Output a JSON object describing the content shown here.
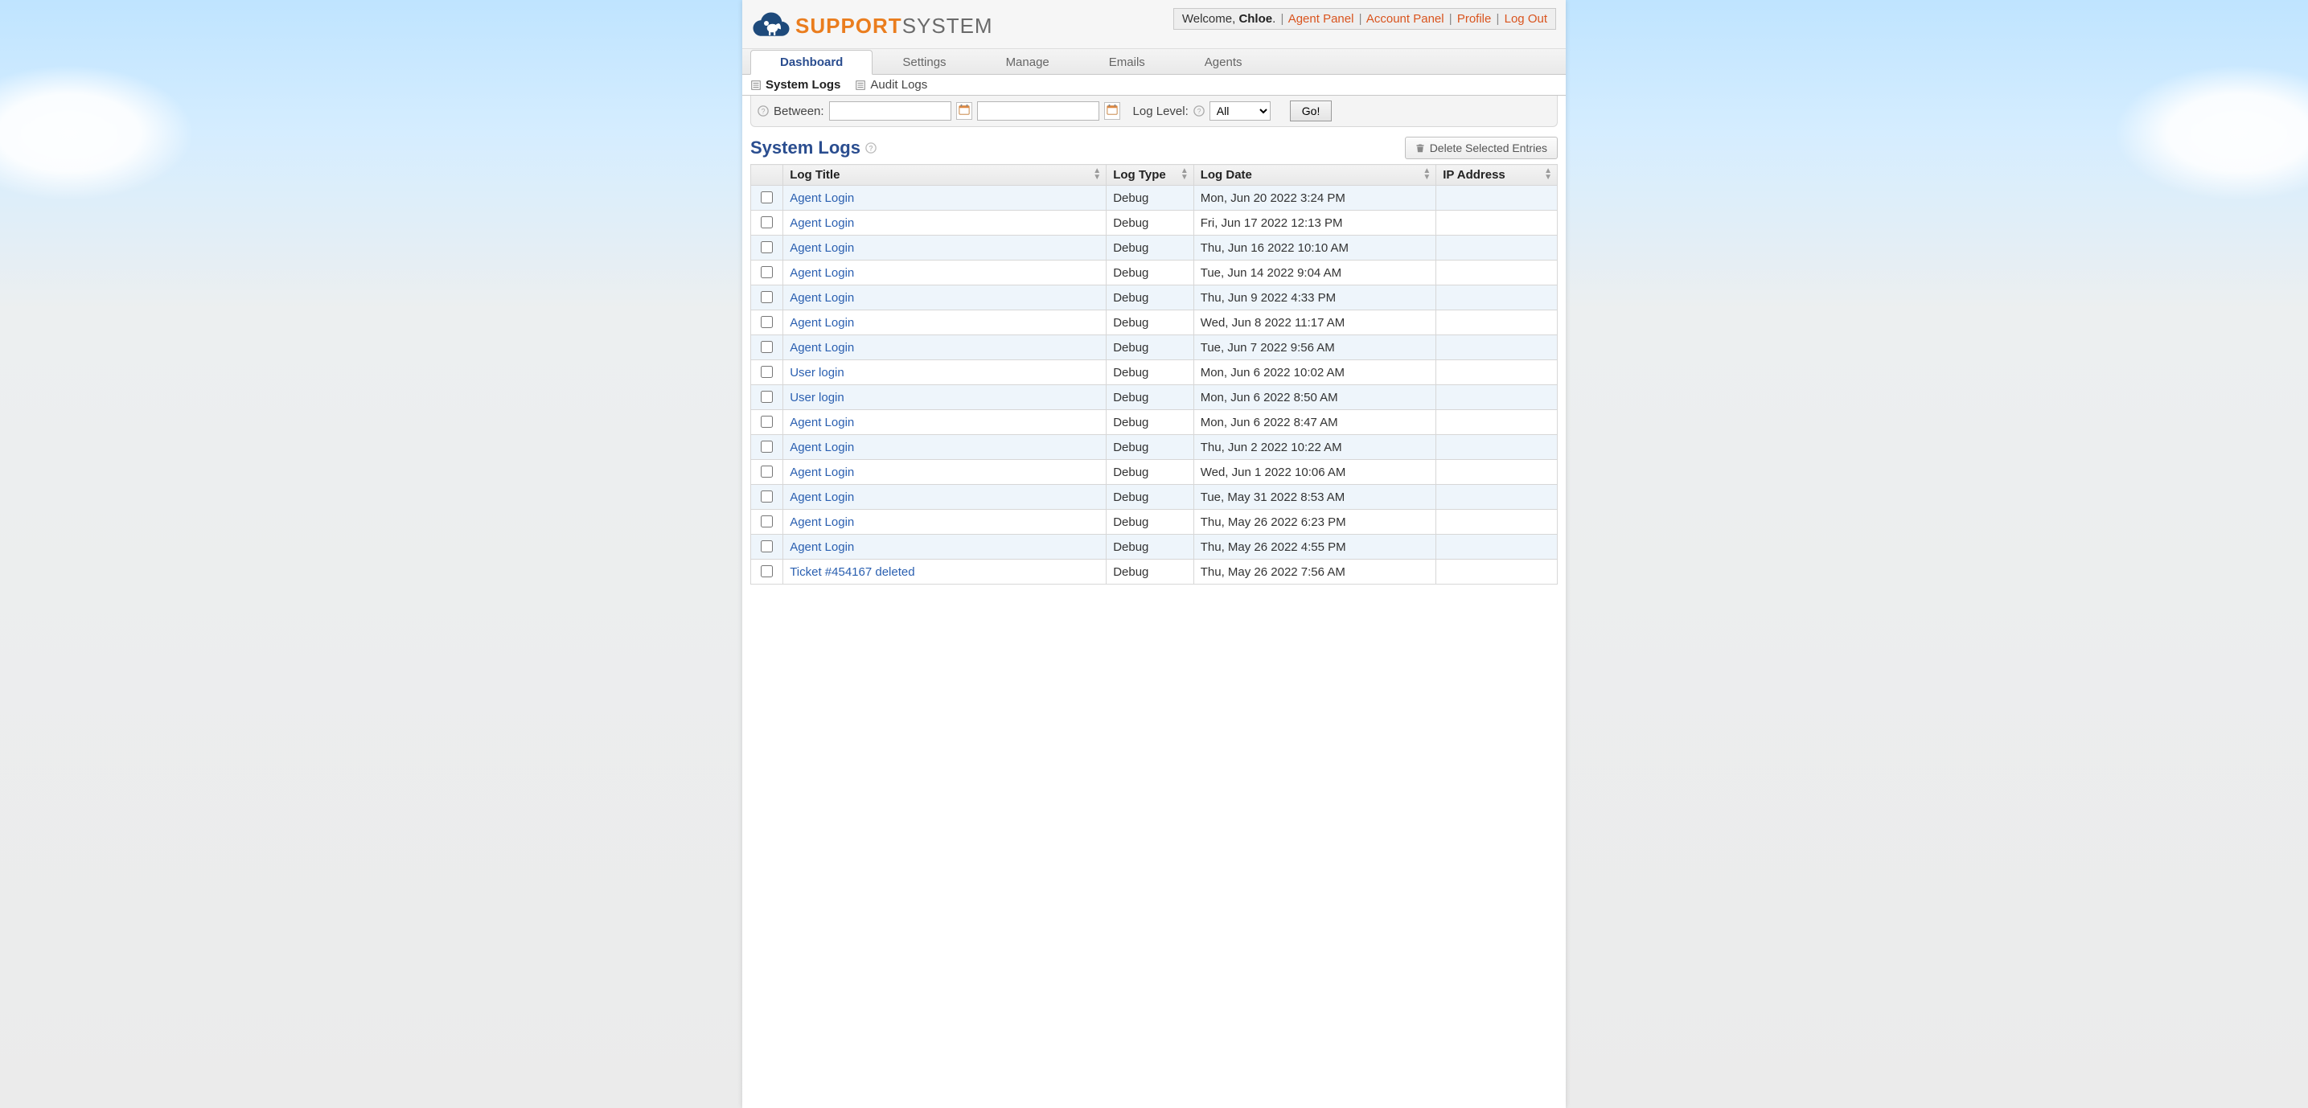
{
  "header": {
    "welcome_prefix": "Welcome, ",
    "username": "Chloe",
    "links": {
      "agent_panel": "Agent Panel",
      "account_panel": "Account Panel",
      "profile": "Profile",
      "logout": "Log Out"
    }
  },
  "logo": {
    "support": "SUPPORT",
    "system": "SYSTEM"
  },
  "tabs": [
    {
      "id": "dashboard",
      "label": "Dashboard",
      "active": true
    },
    {
      "id": "settings",
      "label": "Settings",
      "active": false
    },
    {
      "id": "manage",
      "label": "Manage",
      "active": false
    },
    {
      "id": "emails",
      "label": "Emails",
      "active": false
    },
    {
      "id": "agents",
      "label": "Agents",
      "active": false
    }
  ],
  "subtabs": [
    {
      "id": "system-logs",
      "label": "System Logs",
      "active": true
    },
    {
      "id": "audit-logs",
      "label": "Audit Logs",
      "active": false
    }
  ],
  "filter": {
    "between_label": "Between:",
    "date_from": "",
    "date_to": "",
    "log_level_label": "Log Level:",
    "log_level_selected": "All",
    "go_label": "Go!"
  },
  "page_title": "System Logs",
  "delete_button": "Delete Selected Entries",
  "columns": {
    "title": "Log Title",
    "type": "Log Type",
    "date": "Log Date",
    "ip": "IP Address"
  },
  "rows": [
    {
      "title": "Agent Login",
      "type": "Debug",
      "date": "Mon, Jun 20 2022 3:24 PM",
      "ip": ""
    },
    {
      "title": "Agent Login",
      "type": "Debug",
      "date": "Fri, Jun 17 2022 12:13 PM",
      "ip": ""
    },
    {
      "title": "Agent Login",
      "type": "Debug",
      "date": "Thu, Jun 16 2022 10:10 AM",
      "ip": ""
    },
    {
      "title": "Agent Login",
      "type": "Debug",
      "date": "Tue, Jun 14 2022 9:04 AM",
      "ip": ""
    },
    {
      "title": "Agent Login",
      "type": "Debug",
      "date": "Thu, Jun 9 2022 4:33 PM",
      "ip": ""
    },
    {
      "title": "Agent Login",
      "type": "Debug",
      "date": "Wed, Jun 8 2022 11:17 AM",
      "ip": ""
    },
    {
      "title": "Agent Login",
      "type": "Debug",
      "date": "Tue, Jun 7 2022 9:56 AM",
      "ip": ""
    },
    {
      "title": "User login",
      "type": "Debug",
      "date": "Mon, Jun 6 2022 10:02 AM",
      "ip": ""
    },
    {
      "title": "User login",
      "type": "Debug",
      "date": "Mon, Jun 6 2022 8:50 AM",
      "ip": ""
    },
    {
      "title": "Agent Login",
      "type": "Debug",
      "date": "Mon, Jun 6 2022 8:47 AM",
      "ip": ""
    },
    {
      "title": "Agent Login",
      "type": "Debug",
      "date": "Thu, Jun 2 2022 10:22 AM",
      "ip": ""
    },
    {
      "title": "Agent Login",
      "type": "Debug",
      "date": "Wed, Jun 1 2022 10:06 AM",
      "ip": ""
    },
    {
      "title": "Agent Login",
      "type": "Debug",
      "date": "Tue, May 31 2022 8:53 AM",
      "ip": ""
    },
    {
      "title": "Agent Login",
      "type": "Debug",
      "date": "Thu, May 26 2022 6:23 PM",
      "ip": ""
    },
    {
      "title": "Agent Login",
      "type": "Debug",
      "date": "Thu, May 26 2022 4:55 PM",
      "ip": ""
    },
    {
      "title": "Ticket #454167 deleted",
      "type": "Debug",
      "date": "Thu, May 26 2022 7:56 AM",
      "ip": ""
    }
  ]
}
